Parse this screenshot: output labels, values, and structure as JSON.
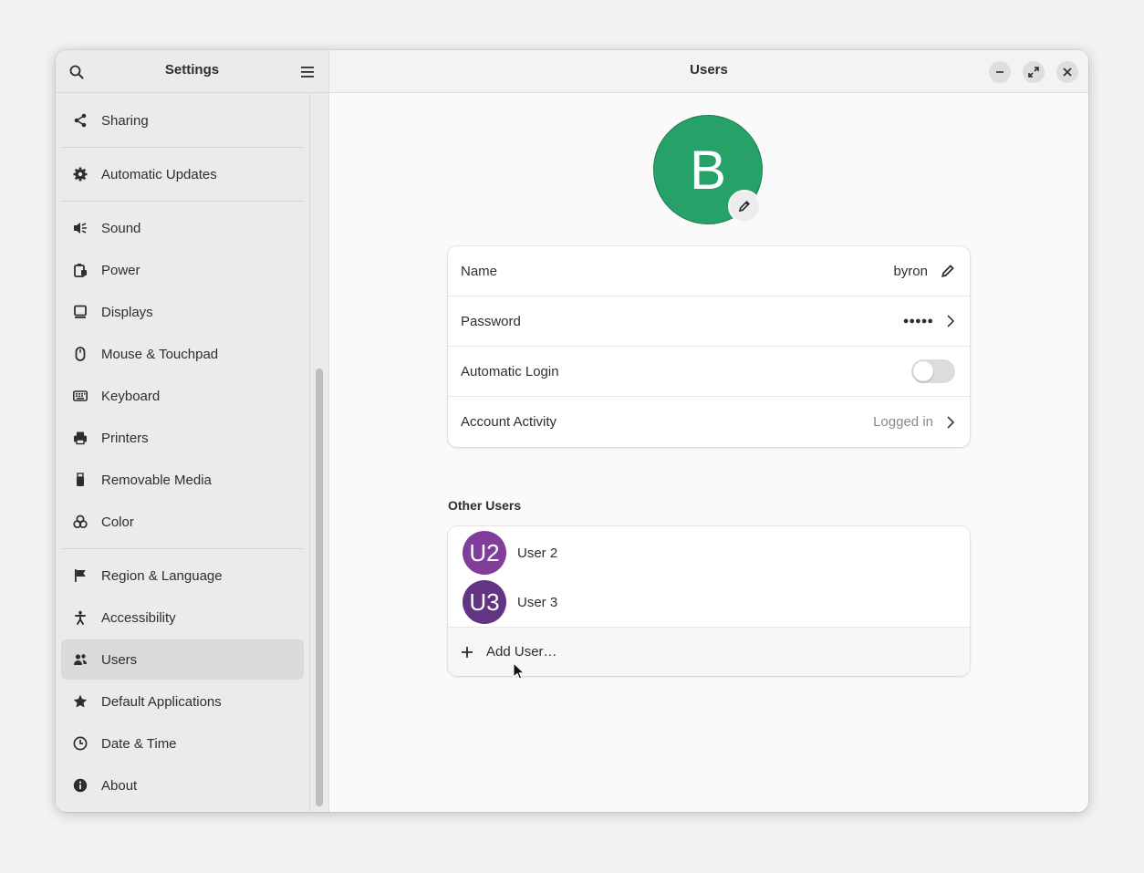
{
  "sidebar": {
    "title": "Settings",
    "items": [
      {
        "label": "Sharing",
        "icon": "share-icon"
      },
      {
        "label": "Automatic Updates",
        "icon": "gear-icon"
      },
      {
        "label": "Sound",
        "icon": "speaker-icon"
      },
      {
        "label": "Power",
        "icon": "battery-icon"
      },
      {
        "label": "Displays",
        "icon": "monitor-icon"
      },
      {
        "label": "Mouse & Touchpad",
        "icon": "mouse-icon"
      },
      {
        "label": "Keyboard",
        "icon": "keyboard-icon"
      },
      {
        "label": "Printers",
        "icon": "printer-icon"
      },
      {
        "label": "Removable Media",
        "icon": "usb-icon"
      },
      {
        "label": "Color",
        "icon": "color-icon"
      },
      {
        "label": "Region & Language",
        "icon": "flag-icon"
      },
      {
        "label": "Accessibility",
        "icon": "accessibility-icon"
      },
      {
        "label": "Users",
        "icon": "users-icon",
        "active": true
      },
      {
        "label": "Default Applications",
        "icon": "star-icon"
      },
      {
        "label": "Date & Time",
        "icon": "clock-icon"
      },
      {
        "label": "About",
        "icon": "info-icon"
      }
    ]
  },
  "header": {
    "title": "Users"
  },
  "user": {
    "initial": "B",
    "avatar_color": "#26a269",
    "name_label": "Name",
    "name_value": "byron",
    "password_label": "Password",
    "password_value": "●●●●●",
    "autologin_label": "Automatic Login",
    "autologin_on": false,
    "activity_label": "Account Activity",
    "activity_value": "Logged in"
  },
  "other_users": {
    "title": "Other Users",
    "users": [
      {
        "initials": "U2",
        "name": "User 2",
        "color": "#813d9c"
      },
      {
        "initials": "U3",
        "name": "User 3",
        "color": "#613583"
      }
    ],
    "add_label": "Add User…"
  }
}
